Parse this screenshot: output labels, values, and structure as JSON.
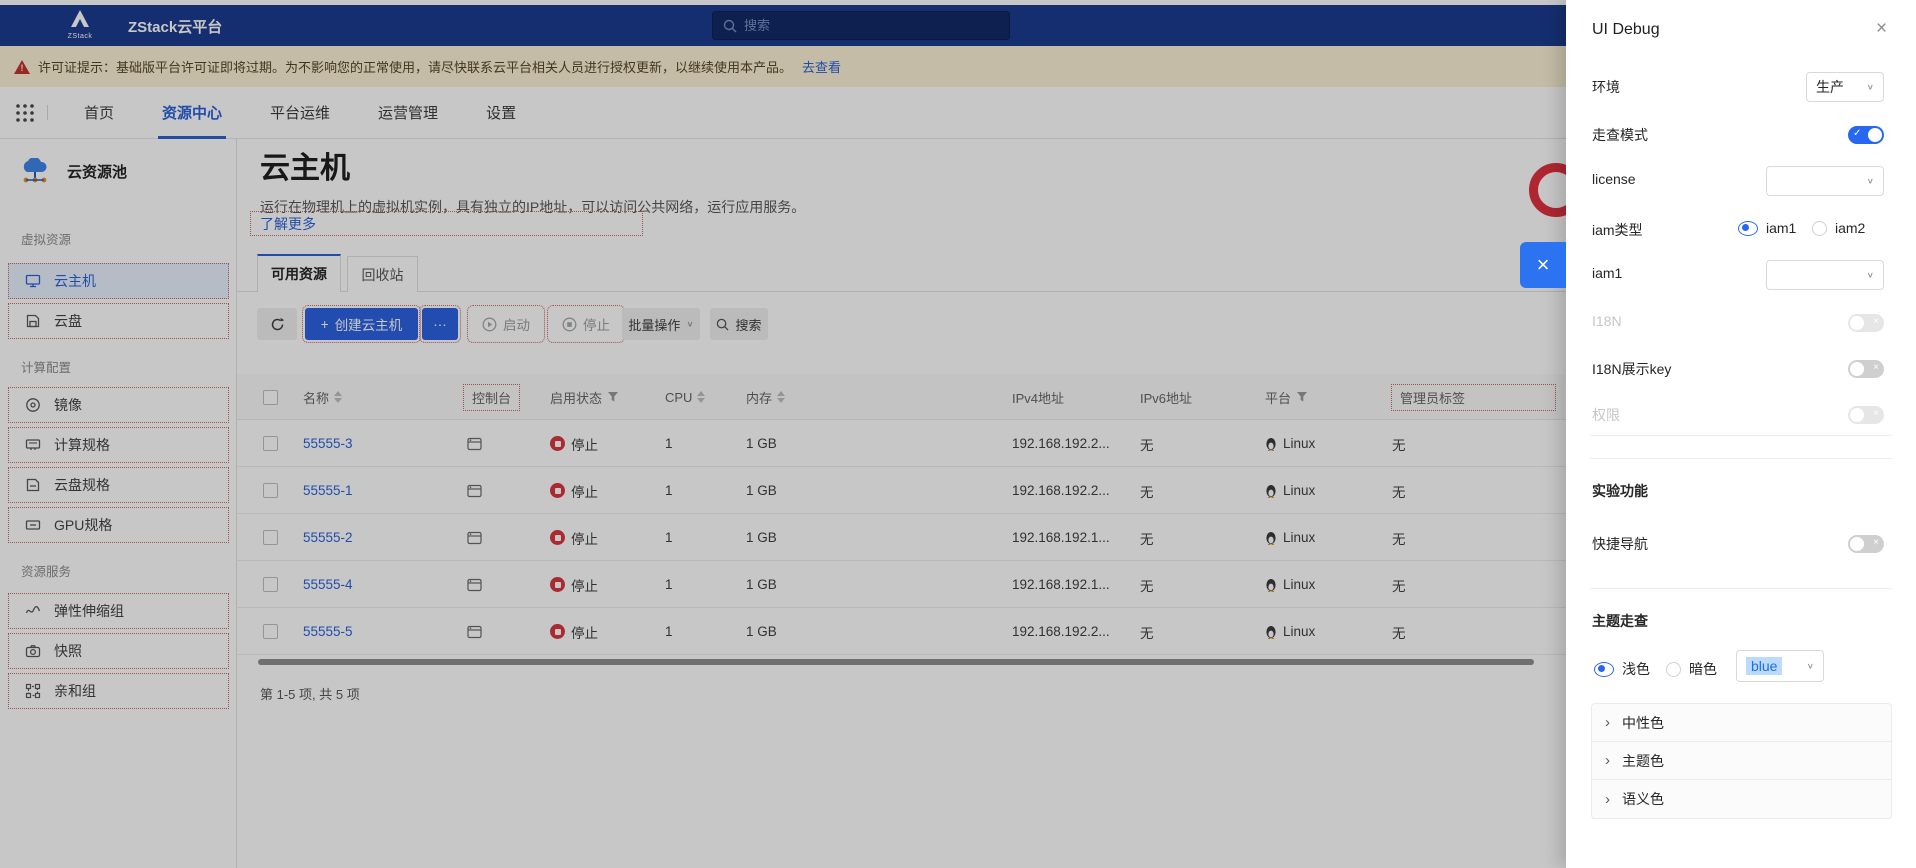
{
  "navbar": {
    "logo_text": "ZStack",
    "title": "ZStack云平台",
    "search_placeholder": "搜索"
  },
  "banner": {
    "text": "许可证提示：基础版平台许可证即将过期。为不影响您的正常使用，请尽快联系云平台相关人员进行授权更新，以继续使用本产品。",
    "link": "去查看"
  },
  "nav": {
    "items": [
      {
        "label": "首页"
      },
      {
        "label": "资源中心"
      },
      {
        "label": "平台运维"
      },
      {
        "label": "运营管理"
      },
      {
        "label": "设置"
      }
    ]
  },
  "sidebar": {
    "title": "云资源池",
    "groups": [
      {
        "label": "虚拟资源",
        "items": [
          {
            "label": "云主机"
          },
          {
            "label": "云盘"
          }
        ]
      },
      {
        "label": "计算配置",
        "items": [
          {
            "label": "镜像"
          },
          {
            "label": "计算规格"
          },
          {
            "label": "云盘规格"
          },
          {
            "label": "GPU规格"
          }
        ]
      },
      {
        "label": "资源服务",
        "items": [
          {
            "label": "弹性伸缩组"
          },
          {
            "label": "快照"
          },
          {
            "label": "亲和组"
          }
        ]
      }
    ]
  },
  "main": {
    "title": "云主机",
    "description": "运行在物理机上的虚拟机实例，具有独立的IP地址，可以访问公共网络，运行应用服务。",
    "learn_more": "了解更多",
    "tabs": [
      {
        "label": "可用资源"
      },
      {
        "label": "回收站"
      }
    ],
    "toolbar": {
      "create": "创建云主机",
      "start": "启动",
      "stop": "停止",
      "batch": "批量操作",
      "search": "搜索"
    },
    "table": {
      "columns": [
        {
          "label": "名称"
        },
        {
          "label": "控制台"
        },
        {
          "label": "启用状态"
        },
        {
          "label": "CPU"
        },
        {
          "label": "内存"
        },
        {
          "label": "IPv4地址"
        },
        {
          "label": "IPv6地址"
        },
        {
          "label": "平台"
        },
        {
          "label": "管理员标签"
        }
      ],
      "rows": [
        {
          "name": "55555-3",
          "status": "停止",
          "cpu": "1",
          "memory": "1 GB",
          "ipv4": "192.168.192.2...",
          "ipv6": "无",
          "platform": "Linux",
          "admin_tag": "无"
        },
        {
          "name": "55555-1",
          "status": "停止",
          "cpu": "1",
          "memory": "1 GB",
          "ipv4": "192.168.192.2...",
          "ipv6": "无",
          "platform": "Linux",
          "admin_tag": "无"
        },
        {
          "name": "55555-2",
          "status": "停止",
          "cpu": "1",
          "memory": "1 GB",
          "ipv4": "192.168.192.1...",
          "ipv6": "无",
          "platform": "Linux",
          "admin_tag": "无"
        },
        {
          "name": "55555-4",
          "status": "停止",
          "cpu": "1",
          "memory": "1 GB",
          "ipv4": "192.168.192.1...",
          "ipv6": "无",
          "platform": "Linux",
          "admin_tag": "无"
        },
        {
          "name": "55555-5",
          "status": "停止",
          "cpu": "1",
          "memory": "1 GB",
          "ipv4": "192.168.192.2...",
          "ipv6": "无",
          "platform": "Linux",
          "admin_tag": "无"
        }
      ],
      "summary": "第 1-5 项, 共 5 项"
    }
  },
  "debug_panel": {
    "title": "UI Debug",
    "env": {
      "label": "环境",
      "value": "生产"
    },
    "walkthrough": {
      "label": "走查模式",
      "on": true
    },
    "license": {
      "label": "license",
      "value": ""
    },
    "iam_type": {
      "label": "iam类型",
      "options": [
        "iam1",
        "iam2"
      ],
      "selected": "iam1"
    },
    "iam1": {
      "label": "iam1",
      "value": ""
    },
    "i18n": {
      "label": "I18N",
      "on": false
    },
    "i18n_key": {
      "label": "I18N展示key",
      "on": false
    },
    "permission": {
      "label": "权限",
      "on": false
    },
    "experimental_header": "实验功能",
    "quick_nav": {
      "label": "快捷导航",
      "on": false
    },
    "theme_header": "主题走查",
    "theme": {
      "light": "浅色",
      "dark": "暗色",
      "selected": "浅色",
      "color_value": "blue"
    },
    "collapse": [
      "中性色",
      "主题色",
      "语义色"
    ],
    "colors": {
      "primary": "#2b6bf2",
      "ring": "#e0313e",
      "navbar": "#1c3c8f"
    }
  }
}
